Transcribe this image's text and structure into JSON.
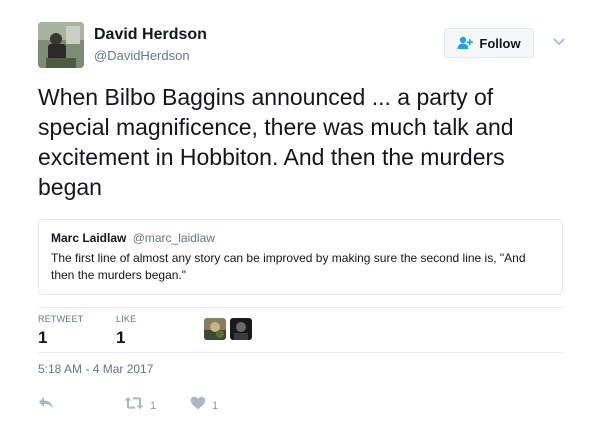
{
  "author": {
    "display_name": "David Herdson",
    "screen_name": "@DavidHerdson"
  },
  "follow_button": {
    "label": "Follow",
    "icon": "add-user-icon"
  },
  "menu": {
    "icon": "chevron-down-icon"
  },
  "tweet": {
    "text": "When Bilbo Baggins announced ... a party of special magnificence, there was much talk and excitement in Hobbiton. And then the murders began"
  },
  "quoted_tweet": {
    "display_name": "Marc Laidlaw",
    "screen_name": "@marc_laidlaw",
    "text": "The first line of almost any story can be improved by making sure the second line is, \"And then the murders began.\""
  },
  "stats": {
    "retweet_label": "RETWEET",
    "retweet_count": "1",
    "like_label": "LIKE",
    "like_count": "1"
  },
  "timestamp": "5:18 AM - 4 Mar 2017",
  "actions": {
    "reply_icon": "reply-icon",
    "retweet_icon": "retweet-icon",
    "retweet_count": "1",
    "like_icon": "heart-icon",
    "like_count": "1"
  },
  "colors": {
    "text": "#14171a",
    "secondary": "#657786",
    "accent": "#1da1f2",
    "border": "#e1e8ed",
    "action_icon": "#aab8c2"
  }
}
